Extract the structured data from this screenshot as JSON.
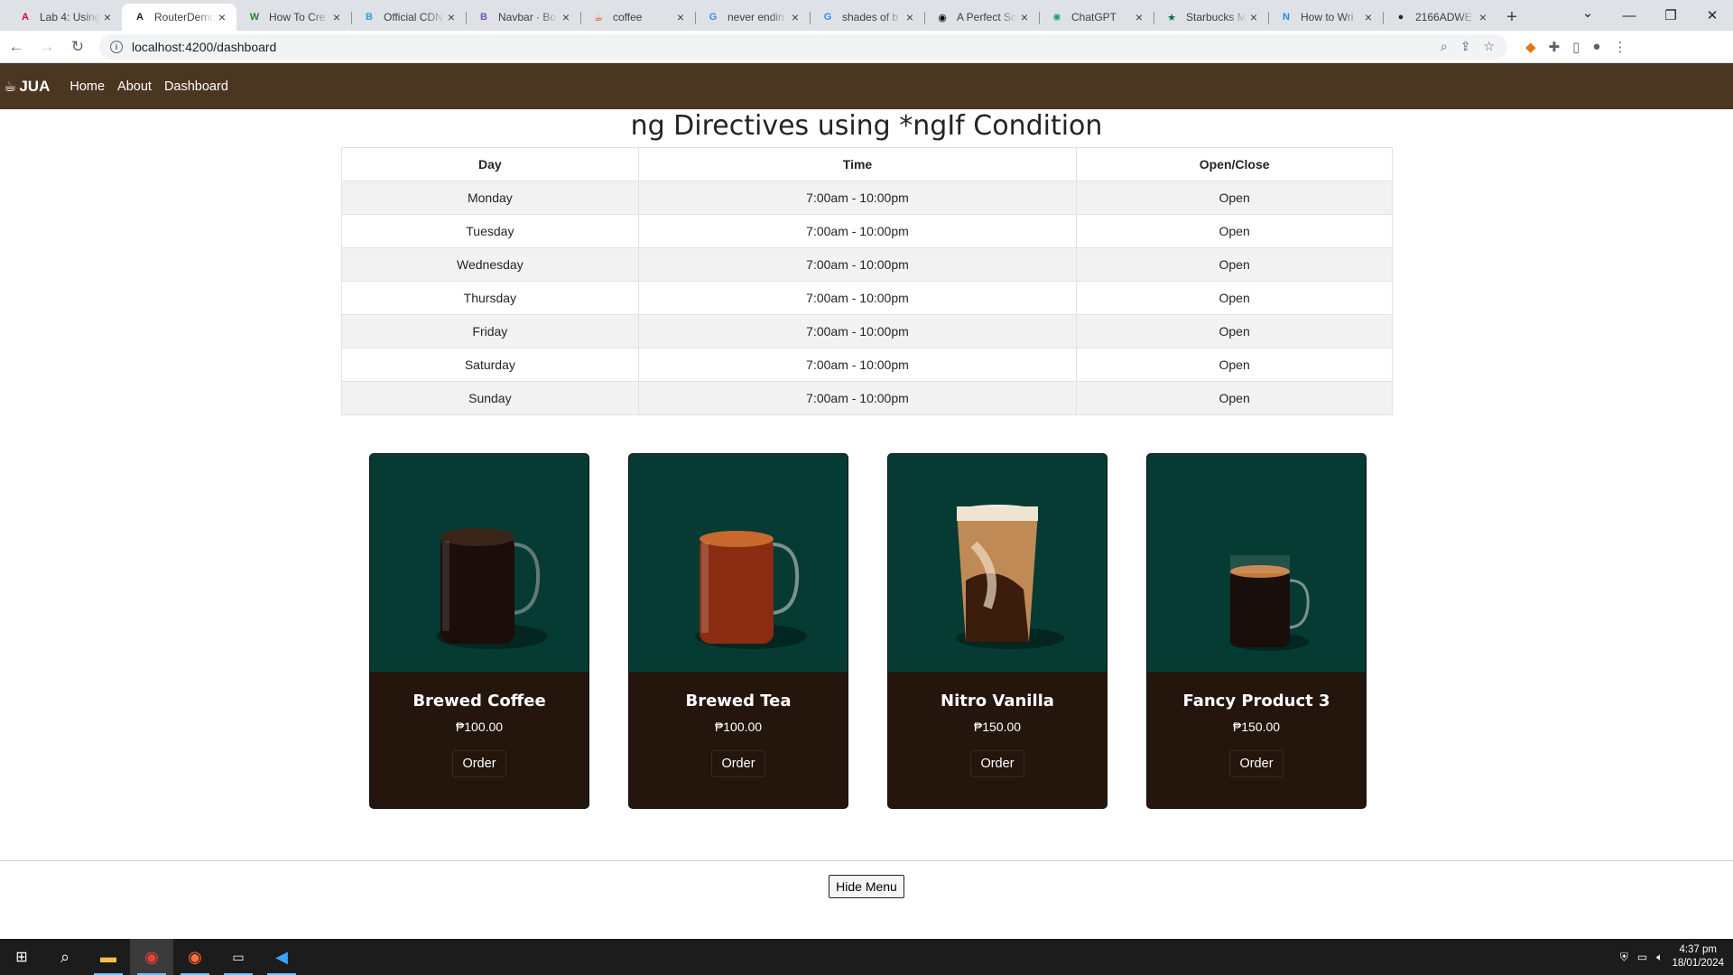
{
  "browser": {
    "tabs": [
      {
        "title": "Lab 4: Using",
        "icon": "angular-red-icon",
        "color": "#dd0031",
        "glyph": "A"
      },
      {
        "title": "RouterDemo",
        "icon": "angular-icon",
        "color": "#202124",
        "glyph": "A",
        "active": true
      },
      {
        "title": "How To Cre",
        "icon": "wikihow-icon",
        "color": "#2e7d32",
        "glyph": "W"
      },
      {
        "title": "Official CDN",
        "icon": "bootstrap-cdn-icon",
        "color": "#2a9fd6",
        "glyph": "B"
      },
      {
        "title": "Navbar · Bo",
        "icon": "bootstrap-icon",
        "color": "#7952b3",
        "glyph": "B"
      },
      {
        "title": "coffee",
        "icon": "coffee-tab-icon",
        "color": "#e65100",
        "glyph": "☕"
      },
      {
        "title": "never endin",
        "icon": "google-icon",
        "color": "#4285f4",
        "glyph": "G"
      },
      {
        "title": "shades of b",
        "icon": "google-icon",
        "color": "#4285f4",
        "glyph": "G"
      },
      {
        "title": "A Perfect Sc",
        "icon": "medium-icon",
        "color": "#000000",
        "glyph": "◉"
      },
      {
        "title": "ChatGPT",
        "icon": "chatgpt-icon",
        "color": "#10a37f",
        "glyph": "✺"
      },
      {
        "title": "Starbucks M",
        "icon": "starbucks-icon",
        "color": "#00704a",
        "glyph": "★"
      },
      {
        "title": "How to Wri",
        "icon": "notion-icon",
        "color": "#1e88e5",
        "glyph": "N"
      },
      {
        "title": "2166ADWE",
        "icon": "github-icon",
        "color": "#24292f",
        "glyph": "●"
      }
    ],
    "url": "localhost:4200/dashboard"
  },
  "navbar": {
    "brand": "JUA",
    "links": [
      "Home",
      "About",
      "Dashboard"
    ]
  },
  "page": {
    "title": "ng Directives using *ngIf Condition"
  },
  "hours": {
    "headers": [
      "Day",
      "Time",
      "Open/Close"
    ],
    "rows": [
      [
        "Monday",
        "7:00am - 10:00pm",
        "Open"
      ],
      [
        "Tuesday",
        "7:00am - 10:00pm",
        "Open"
      ],
      [
        "Wednesday",
        "7:00am - 10:00pm",
        "Open"
      ],
      [
        "Thursday",
        "7:00am - 10:00pm",
        "Open"
      ],
      [
        "Friday",
        "7:00am - 10:00pm",
        "Open"
      ],
      [
        "Saturday",
        "7:00am - 10:00pm",
        "Open"
      ],
      [
        "Sunday",
        "7:00am - 10:00pm",
        "Open"
      ]
    ]
  },
  "products": [
    {
      "name": "Brewed Coffee",
      "price": "₱100.00",
      "button": "Order",
      "image": "coffee-mug"
    },
    {
      "name": "Brewed Tea",
      "price": "₱100.00",
      "button": "Order",
      "image": "tea-mug"
    },
    {
      "name": "Nitro Vanilla",
      "price": "₱150.00",
      "button": "Order",
      "image": "nitro-glass"
    },
    {
      "name": "Fancy Product 3",
      "price": "₱150.00",
      "button": "Order",
      "image": "small-mug"
    }
  ],
  "footer": {
    "hide_button": "Hide Menu"
  },
  "taskbar": {
    "time": "4:37 pm",
    "date": "18/01/2024"
  }
}
